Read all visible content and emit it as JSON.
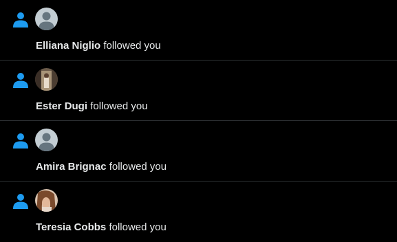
{
  "notifications": [
    {
      "icon": "person-icon",
      "avatar": "default",
      "name": "Elliana Niglio",
      "action": "followed you"
    },
    {
      "icon": "person-icon",
      "avatar": "photo-street",
      "name": "Ester Dugi",
      "action": "followed you"
    },
    {
      "icon": "person-icon",
      "avatar": "default",
      "name": "Amira Brignac",
      "action": "followed you"
    },
    {
      "icon": "person-icon",
      "avatar": "photo-portrait",
      "name": "Teresia Cobbs",
      "action": "followed you"
    }
  ],
  "colors": {
    "accent": "#1d9bf0",
    "background": "#000000",
    "divider": "#2f3336",
    "text": "#e7e9ea"
  }
}
